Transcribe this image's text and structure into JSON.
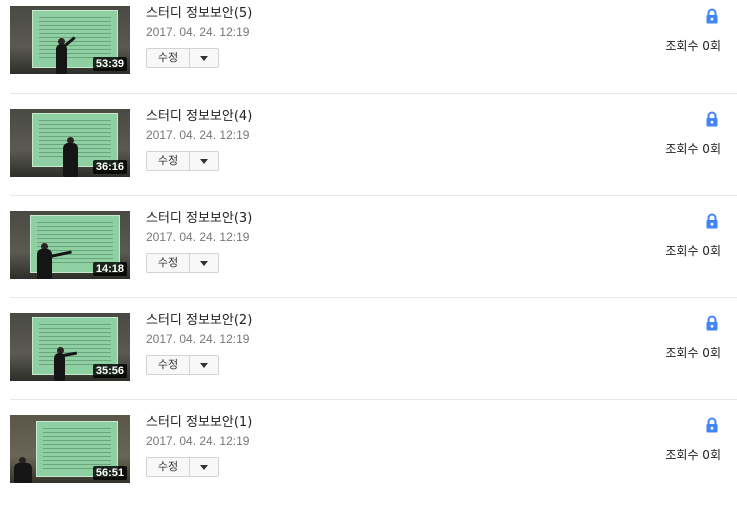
{
  "videos": [
    {
      "title": "스터디 정보보안(5)",
      "date": "2017. 04. 24. 12:19",
      "duration": "53:39",
      "edit_label": "수정",
      "views": "조회수 0회",
      "privacy_icon": "lock-icon"
    },
    {
      "title": "스터디 정보보안(4)",
      "date": "2017. 04. 24. 12:19",
      "duration": "36:16",
      "edit_label": "수정",
      "views": "조회수 0회",
      "privacy_icon": "lock-icon"
    },
    {
      "title": "스터디 정보보안(3)",
      "date": "2017. 04. 24. 12:19",
      "duration": "14:18",
      "edit_label": "수정",
      "views": "조회수 0회",
      "privacy_icon": "lock-icon"
    },
    {
      "title": "스터디 정보보안(2)",
      "date": "2017. 04. 24. 12:19",
      "duration": "35:56",
      "edit_label": "수정",
      "views": "조회수 0회",
      "privacy_icon": "lock-icon"
    },
    {
      "title": "스터디 정보보안(1)",
      "date": "2017. 04. 24. 12:19",
      "duration": "56:51",
      "edit_label": "수정",
      "views": "조회수 0회",
      "privacy_icon": "lock-icon"
    }
  ],
  "colors": {
    "lock": "#4285f4",
    "duration_bg": "#000000",
    "date_text": "#777777",
    "divider": "#e6e6e6"
  }
}
